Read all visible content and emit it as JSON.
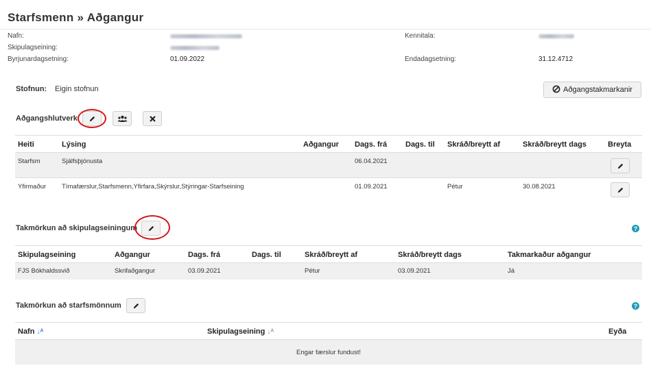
{
  "page": {
    "title": "Starfsmenn » Aðgangur"
  },
  "info": {
    "nafn_label": "Nafn:",
    "kennitala_label": "Kennitala:",
    "skipulagseining_label": "Skipulagseining:",
    "byrjun_label": "Byrjunardagsetning:",
    "byrjun_value": "01.09.2022",
    "enda_label": "Endadagsetning:",
    "enda_value": "31.12.4712"
  },
  "stofnun": {
    "label": "Stofnun:",
    "value": "Eigin stofnun"
  },
  "restrictions_button": {
    "label": "Aðgangstakmarkanir",
    "icon": "ban-icon"
  },
  "roles": {
    "title": "Aðgangshlutverk",
    "columns": [
      "Heiti",
      "Lýsing",
      "Aðgangur",
      "Dags. frá",
      "Dags. til",
      "Skráð/breytt af",
      "Skráð/breytt dags",
      "Breyta"
    ],
    "rows": [
      {
        "heiti": "Starfsm",
        "lysing": "Sjálfsþjónusta",
        "adgangur": "",
        "fra": "06.04.2021",
        "til": "",
        "af": "",
        "dags": ""
      },
      {
        "heiti": "Yfirmaður",
        "lysing": "Tímafærslur,Starfsmenn,Yfirfara,Skýrslur,Stýringar-Starfseining",
        "adgangur": "",
        "fra": "01.09.2021",
        "til": "",
        "af": "Pétur",
        "dags": "30.08.2021"
      }
    ]
  },
  "org_restrict": {
    "title": "Takmörkun að skipulagseiningum",
    "columns": [
      "Skipulagseining",
      "Aðgangur",
      "Dags. frá",
      "Dags. til",
      "Skráð/breytt af",
      "Skráð/breytt dags",
      "Takmarkaður aðgangur"
    ],
    "rows": [
      {
        "eining": "FJS Bókhaldssvið",
        "adgangur": "Skrifaðgangur",
        "fra": "03.09.2021",
        "til": "",
        "af": "Pétur",
        "dags": "03.09.2021",
        "takmarkadur": "Já"
      }
    ]
  },
  "staff_restrict": {
    "title": "Takmörkun að starfsmönnum",
    "columns": [
      "Nafn",
      "Skipulagseining",
      "Eyða"
    ],
    "empty_message": "Engar færslur fundust!"
  },
  "colors": {
    "accent_red": "#d41515",
    "help_teal": "#1d9bb7",
    "sort_blue": "#3a7bd5"
  }
}
